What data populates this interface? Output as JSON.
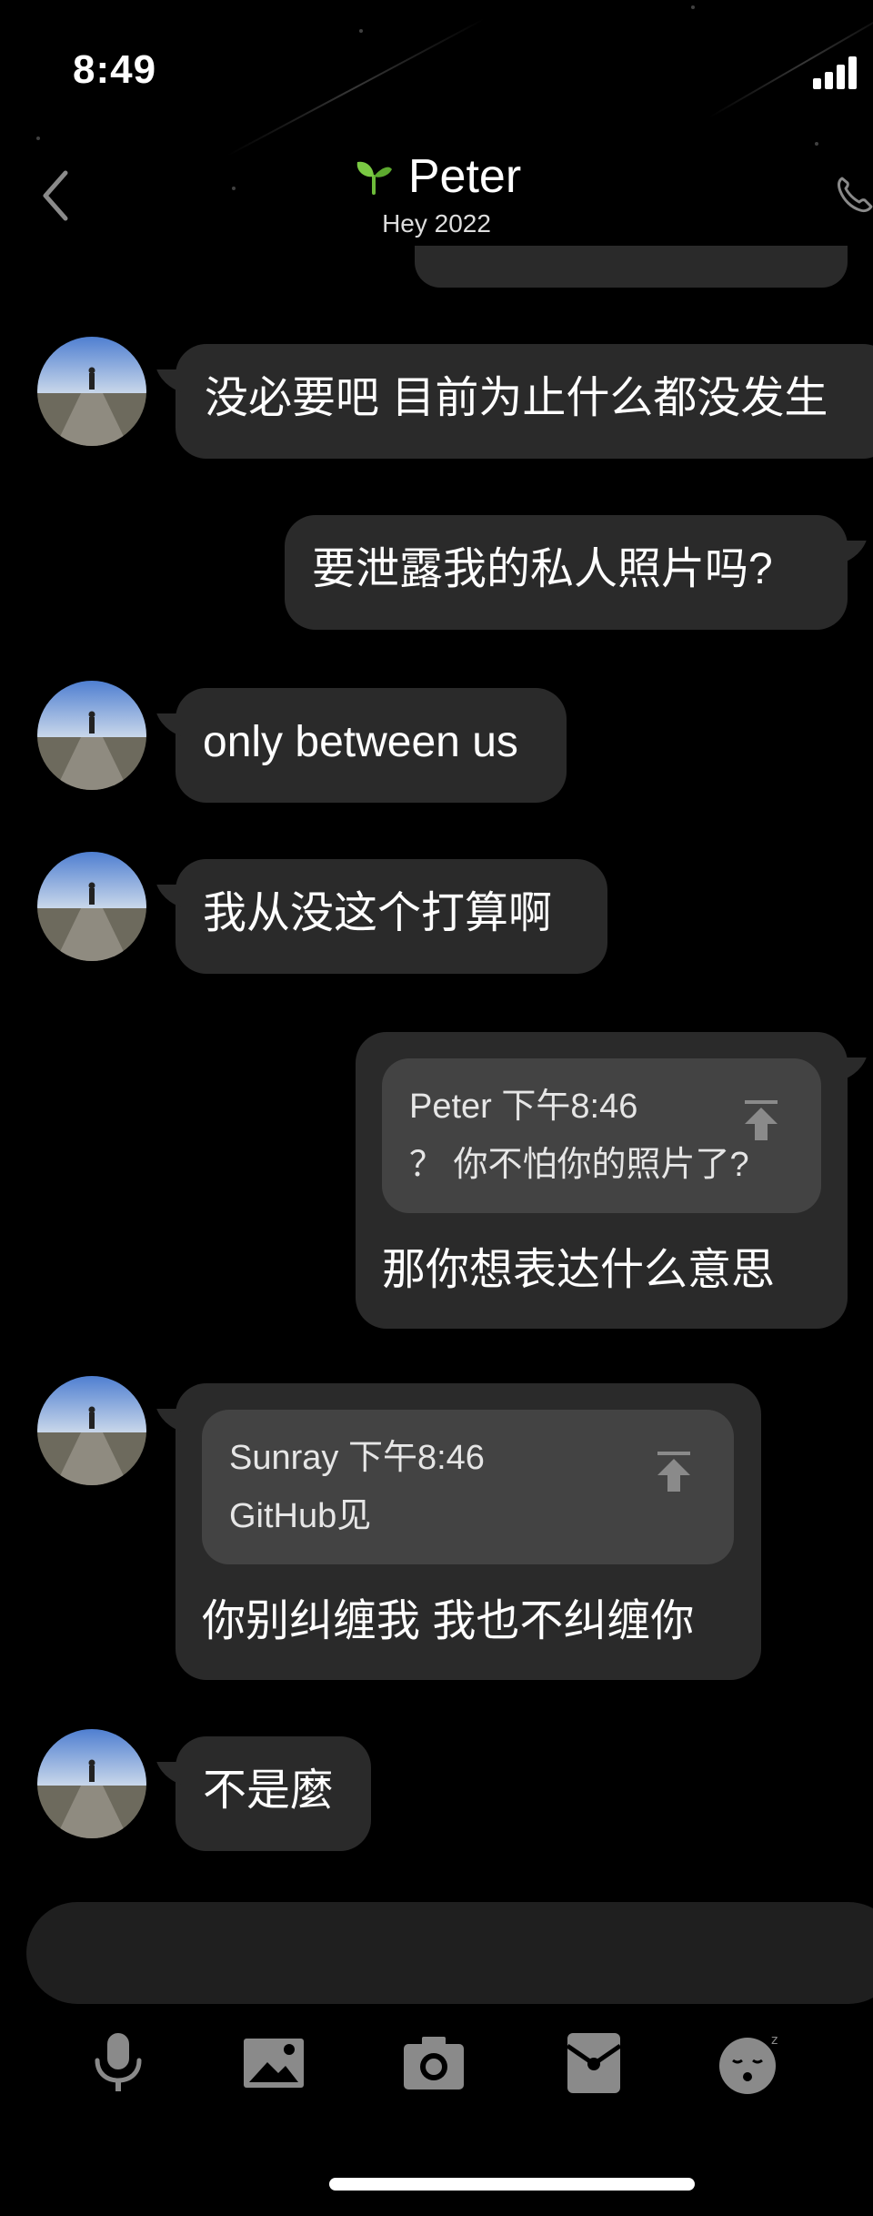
{
  "status_bar": {
    "time": "8:49"
  },
  "header": {
    "contact_name": "Peter",
    "contact_status": "Hey 2022",
    "icons": [
      "back-icon",
      "sprout-icon",
      "phone-icon"
    ]
  },
  "messages": [
    {
      "side": "left",
      "text": "没必要吧 目前为止什么都没发生"
    },
    {
      "side": "right",
      "text": "要泄露我的私人照片吗?"
    },
    {
      "side": "left",
      "text": "only between us"
    },
    {
      "side": "left",
      "text": "我从没这个打算啊"
    },
    {
      "side": "right",
      "quote": {
        "sender_time": "Peter 下午8:46",
        "text": "？ 你不怕你的照片了?"
      },
      "text": "那你想表达什么意思"
    },
    {
      "side": "left",
      "quote": {
        "sender_time": "Sunray 下午8:46",
        "text": "GitHub见"
      },
      "text": "你别纠缠我 我也不纠缠你"
    },
    {
      "side": "left",
      "text": "不是麼"
    }
  ],
  "toolbar": {
    "icons": [
      "microphone-icon",
      "image-icon",
      "camera-icon",
      "red-packet-icon",
      "emoji-icon"
    ]
  },
  "colors": {
    "background": "#000000",
    "bubble": "#2a2a2a",
    "quote": "#434343"
  }
}
